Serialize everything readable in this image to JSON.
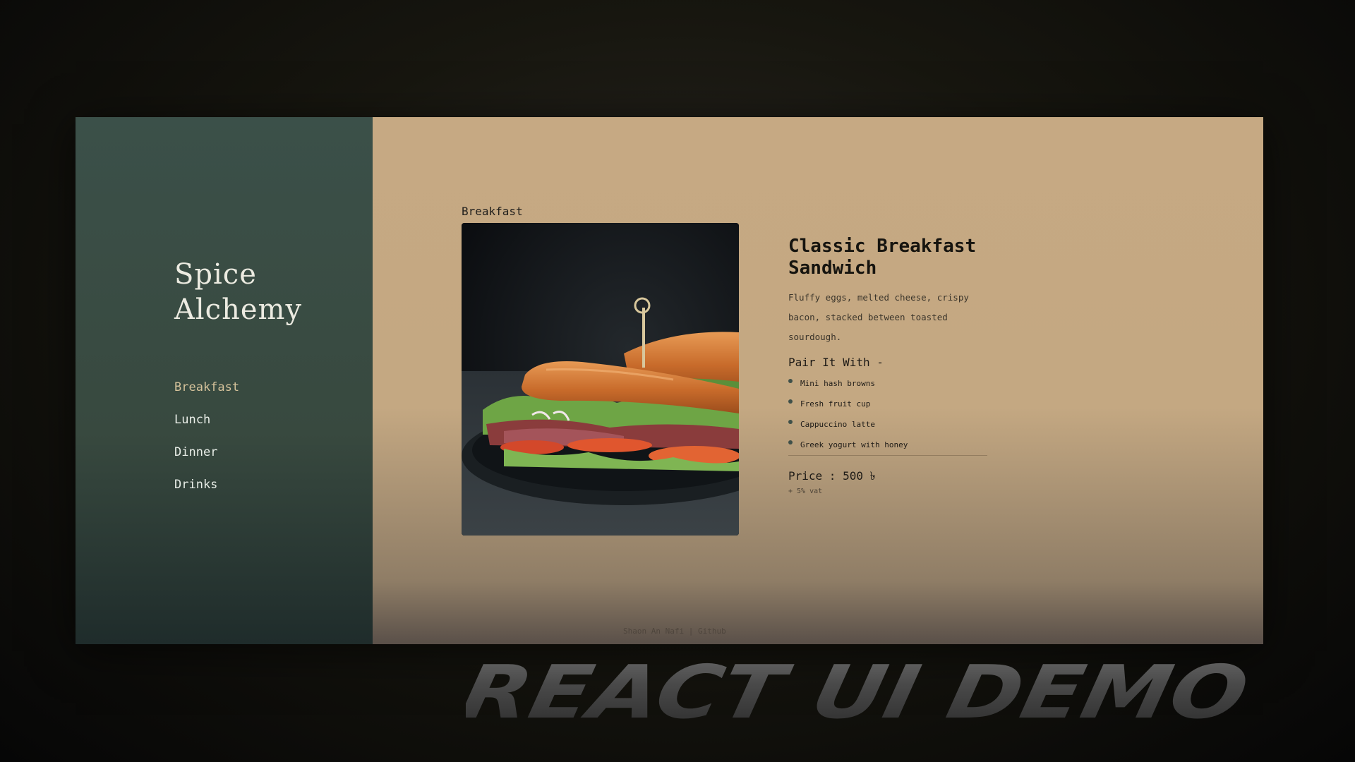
{
  "brand": {
    "line1": "Spice",
    "line2": "Alchemy"
  },
  "nav": {
    "items": [
      "Breakfast",
      "Lunch",
      "Dinner",
      "Drinks"
    ],
    "active": "Breakfast"
  },
  "main": {
    "category": "Breakfast",
    "dish": {
      "title_line1": "Classic Breakfast",
      "title_line2": "Sandwich",
      "description": "Fluffy eggs, melted cheese, crispy bacon, stacked between toasted sourdough.",
      "image_icon": "sandwich-photo"
    },
    "pairing": {
      "heading": "Pair It With -",
      "items": [
        "Mini hash browns",
        "Fresh fruit cup",
        "Cappuccino latte",
        "Greek yogurt with honey"
      ]
    },
    "price": {
      "label": "Price : 500 ৳",
      "vat": "+ 5% vat"
    }
  },
  "footer": {
    "author": "Shaon An Nafi",
    "separator": "|",
    "link": "Github"
  },
  "banner": {
    "text": "REACT UI DEMO"
  },
  "colors": {
    "sidebar": "#3b5049",
    "main_bg": "#c6a983",
    "nav_active": "#d6c39b",
    "bullet": "#3f5049"
  }
}
